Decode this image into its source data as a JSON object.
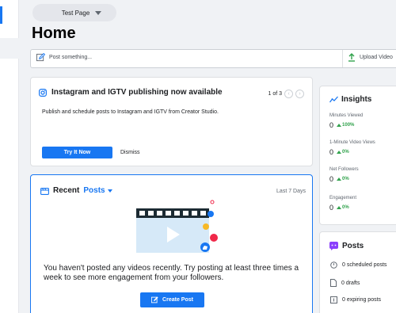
{
  "header": {
    "page_selector": "Test Page",
    "title": "Home"
  },
  "composer": {
    "post_label": "Post something...",
    "upload_label": "Upload Video"
  },
  "instagram_card": {
    "title": "Instagram and IGTV publishing now available",
    "pager": "1 of 3",
    "prev_glyph": "‹",
    "next_glyph": "›",
    "description": "Publish and schedule posts to Instagram and IGTV from Creator Studio.",
    "try_label": "Try It Now",
    "dismiss_label": "Dismiss"
  },
  "recent": {
    "label": "Recent",
    "filter": "Posts",
    "range": "Last 7 Days",
    "empty_message": "You haven't posted any videos recently. Try posting at least three times a week to see more engagement from your followers.",
    "create_label": "Create Post"
  },
  "insights": {
    "title": "Insights",
    "metrics": [
      {
        "label": "Minutes Viewed",
        "value": "0",
        "change": "100%"
      },
      {
        "label": "1-Minute Video Views",
        "value": "0",
        "change": "0%"
      },
      {
        "label": "Net Followers",
        "value": "0",
        "change": "0%"
      },
      {
        "label": "Engagement",
        "value": "0",
        "change": "0%"
      }
    ]
  },
  "posts_panel": {
    "title": "Posts",
    "rows": [
      {
        "icon": "clock-icon",
        "label": "0 scheduled posts"
      },
      {
        "icon": "document-icon",
        "label": "0 drafts"
      },
      {
        "icon": "calendar-icon",
        "label": "0 expiring posts"
      }
    ]
  },
  "colors": {
    "accent": "#1877f2",
    "positive": "#31a24c",
    "background": "#f0f2f5"
  }
}
